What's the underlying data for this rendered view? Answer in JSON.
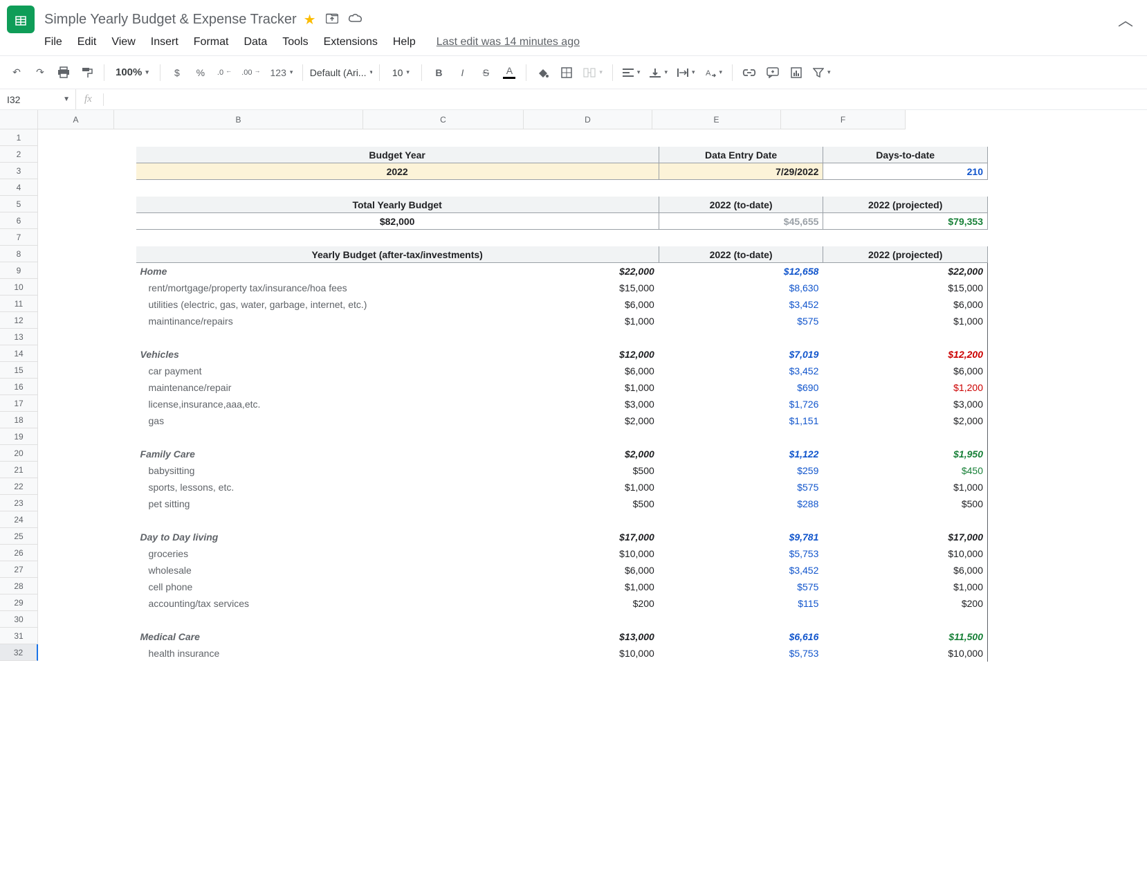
{
  "doc": {
    "title": "Simple Yearly Budget & Expense Tracker",
    "last_edit": "Last edit was 14 minutes ago"
  },
  "menu": {
    "file": "File",
    "edit": "Edit",
    "view": "View",
    "insert": "Insert",
    "format": "Format",
    "data": "Data",
    "tools": "Tools",
    "extensions": "Extensions",
    "help": "Help"
  },
  "toolbar": {
    "zoom": "100%",
    "currency": "$",
    "percent": "%",
    "dec_dec": ".0",
    "inc_dec": ".00",
    "numfmt": "123",
    "font": "Default (Ari...",
    "size": "10"
  },
  "namebox": {
    "ref": "I32",
    "fx": "fx"
  },
  "cols": [
    "A",
    "B",
    "C",
    "D",
    "E",
    "F"
  ],
  "headers1": {
    "budget_year": "Budget Year",
    "data_entry": "Data Entry Date",
    "days": "Days-to-date"
  },
  "vals1": {
    "year": "2022",
    "date": "7/29/2022",
    "days": "210"
  },
  "headers2": {
    "total": "Total Yearly Budget",
    "todate": "2022 (to-date)",
    "proj": "2022 (projected)"
  },
  "vals2": {
    "total": "$82,000",
    "todate": "$45,655",
    "proj": "$79,353"
  },
  "headers3": {
    "yb": "Yearly Budget (after-tax/investments)",
    "todate": "2022 (to-date)",
    "proj": "2022 (projected)"
  },
  "rows": {
    "home": {
      "label": "Home",
      "budget": "$22,000",
      "todate": "$12,658",
      "proj": "$22,000",
      "proj_color": "black"
    },
    "rent": {
      "label": "rent/mortgage/property tax/insurance/hoa fees",
      "budget": "$15,000",
      "todate": "$8,630",
      "proj": "$15,000"
    },
    "util": {
      "label": "utilities (electric, gas, water, garbage, internet, etc.)",
      "budget": "$6,000",
      "todate": "$3,452",
      "proj": "$6,000"
    },
    "maint": {
      "label": "maintinance/repairs",
      "budget": "$1,000",
      "todate": "$575",
      "proj": "$1,000"
    },
    "veh": {
      "label": "Vehicles",
      "budget": "$12,000",
      "todate": "$7,019",
      "proj": "$12,200",
      "proj_color": "red"
    },
    "carpay": {
      "label": "car payment",
      "budget": "$6,000",
      "todate": "$3,452",
      "proj": "$6,000"
    },
    "vmaint": {
      "label": "maintenance/repair",
      "budget": "$1,000",
      "todate": "$690",
      "proj": "$1,200",
      "proj_color": "red_norm"
    },
    "lic": {
      "label": "license,insurance,aaa,etc.",
      "budget": "$3,000",
      "todate": "$1,726",
      "proj": "$3,000"
    },
    "gas": {
      "label": "gas",
      "budget": "$2,000",
      "todate": "$1,151",
      "proj": "$2,000"
    },
    "fam": {
      "label": "Family Care",
      "budget": "$2,000",
      "todate": "$1,122",
      "proj": "$1,950",
      "proj_color": "green"
    },
    "baby": {
      "label": "babysitting",
      "budget": "$500",
      "todate": "$259",
      "proj": "$450",
      "proj_color": "green_norm"
    },
    "sports": {
      "label": "sports, lessons, etc.",
      "budget": "$1,000",
      "todate": "$575",
      "proj": "$1,000"
    },
    "pet": {
      "label": "pet sitting",
      "budget": "$500",
      "todate": "$288",
      "proj": "$500"
    },
    "day": {
      "label": "Day to Day living",
      "budget": "$17,000",
      "todate": "$9,781",
      "proj": "$17,000",
      "proj_color": "black"
    },
    "groc": {
      "label": "groceries",
      "budget": "$10,000",
      "todate": "$5,753",
      "proj": "$10,000"
    },
    "whole": {
      "label": "wholesale",
      "budget": "$6,000",
      "todate": "$3,452",
      "proj": "$6,000"
    },
    "cell": {
      "label": "cell phone",
      "budget": "$1,000",
      "todate": "$575",
      "proj": "$1,000"
    },
    "acct": {
      "label": "accounting/tax services",
      "budget": "$200",
      "todate": "$115",
      "proj": "$200"
    },
    "med": {
      "label": "Medical Care",
      "budget": "$13,000",
      "todate": "$6,616",
      "proj": "$11,500",
      "proj_color": "green"
    },
    "hins": {
      "label": "health insurance",
      "budget": "$10,000",
      "todate": "$5,753",
      "proj": "$10,000"
    }
  }
}
